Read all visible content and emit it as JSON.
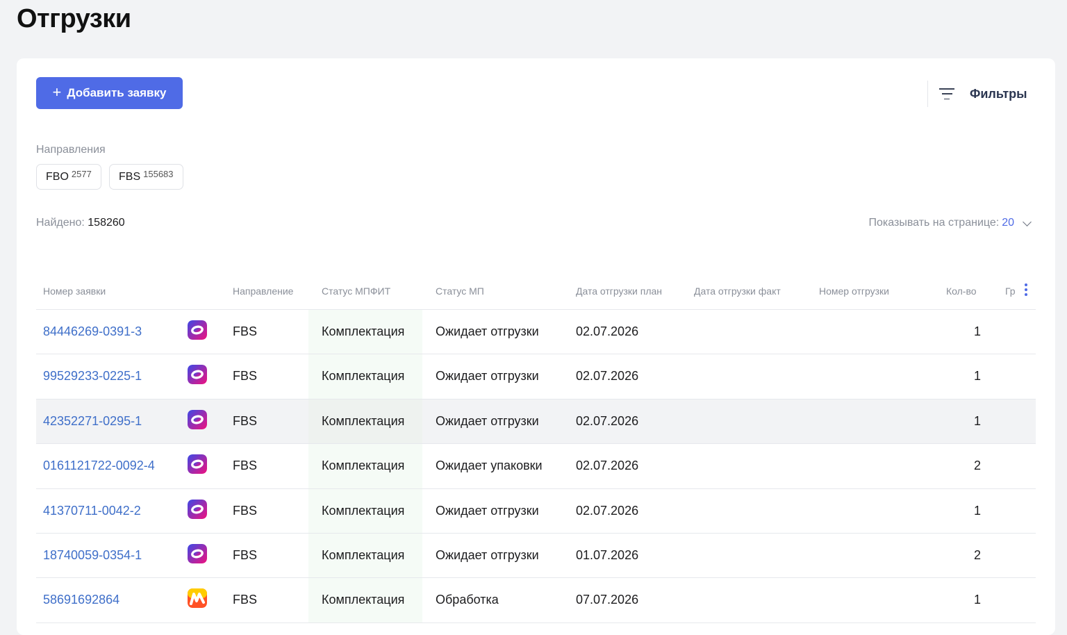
{
  "page": {
    "title": "Отгрузки"
  },
  "toolbar": {
    "add_label": "Добавить заявку",
    "add_icon": "+",
    "filters_label": "Фильтры"
  },
  "directions": {
    "label": "Направления",
    "chips": [
      {
        "label": "FBO",
        "count": "2577"
      },
      {
        "label": "FBS",
        "count": "155683"
      }
    ]
  },
  "summary": {
    "found_label": "Найдено:",
    "found_value": "158260",
    "per_page_label": "Показывать на странице:",
    "per_page_value": "20"
  },
  "table": {
    "columns": [
      "Номер заявки",
      "Направление",
      "Статус МПФИТ",
      "Статус МП",
      "Дата отгрузки план",
      "Дата отгрузки факт",
      "Номер отгрузки",
      "Кол-во",
      "Гр"
    ],
    "rows": [
      {
        "id": "84446269-0391-3",
        "marketplace": "ozon",
        "direction": "FBS",
        "mpfit_status": "Комплектация",
        "mp_status": "Ожидает отгрузки",
        "plan_date": "02.07.2026",
        "fact_date": "",
        "shipment_no": "",
        "qty": "1"
      },
      {
        "id": "99529233-0225-1",
        "marketplace": "ozon",
        "direction": "FBS",
        "mpfit_status": "Комплектация",
        "mp_status": "Ожидает отгрузки",
        "plan_date": "02.07.2026",
        "fact_date": "",
        "shipment_no": "",
        "qty": "1"
      },
      {
        "id": "42352271-0295-1",
        "marketplace": "ozon",
        "direction": "FBS",
        "mpfit_status": "Комплектация",
        "mp_status": "Ожидает отгрузки",
        "plan_date": "02.07.2026",
        "fact_date": "",
        "shipment_no": "",
        "qty": "1"
      },
      {
        "id": "0161121722-0092-4",
        "marketplace": "ozon",
        "direction": "FBS",
        "mpfit_status": "Комплектация",
        "mp_status": "Ожидает упаковки",
        "plan_date": "02.07.2026",
        "fact_date": "",
        "shipment_no": "",
        "qty": "2"
      },
      {
        "id": "41370711-0042-2",
        "marketplace": "ozon",
        "direction": "FBS",
        "mpfit_status": "Комплектация",
        "mp_status": "Ожидает отгрузки",
        "plan_date": "02.07.2026",
        "fact_date": "",
        "shipment_no": "",
        "qty": "1"
      },
      {
        "id": "18740059-0354-1",
        "marketplace": "ozon",
        "direction": "FBS",
        "mpfit_status": "Комплектация",
        "mp_status": "Ожидает отгрузки",
        "plan_date": "01.07.2026",
        "fact_date": "",
        "shipment_no": "",
        "qty": "2"
      },
      {
        "id": "58691692864",
        "marketplace": "yandex-market",
        "direction": "FBS",
        "mpfit_status": "Комплектация",
        "mp_status": "Обработка",
        "plan_date": "07.07.2026",
        "fact_date": "",
        "shipment_no": "",
        "qty": "1"
      }
    ]
  },
  "colors": {
    "accent": "#4f6be6",
    "link": "#3f6fc9",
    "muted": "#8a8f99",
    "row_highlight": "#f2f3f5"
  },
  "icons": {
    "filters": "filter-lines-icon",
    "per_page": "chevron-down-icon",
    "columns_menu": "kebab-vertical-icon"
  }
}
